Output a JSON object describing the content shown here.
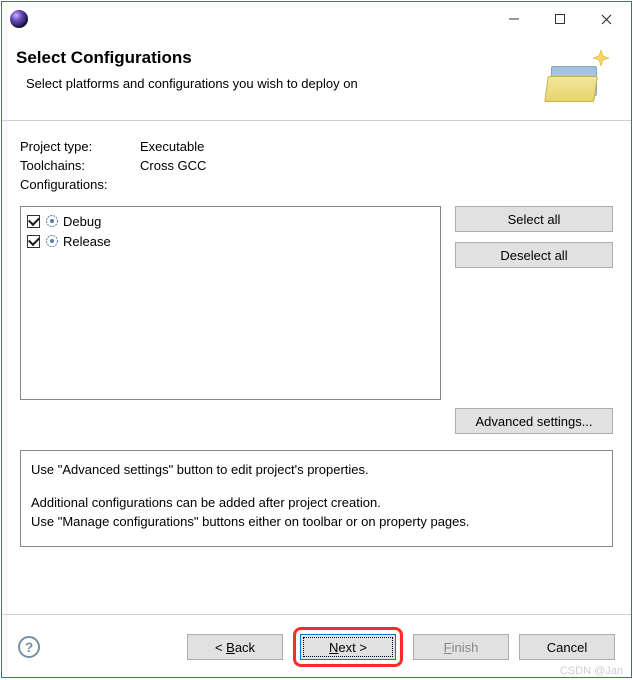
{
  "banner": {
    "title": "Select Configurations",
    "subtitle": "Select platforms and configurations you wish to deploy on"
  },
  "fields": {
    "project_type_label": "Project type:",
    "project_type_value": "Executable",
    "toolchains_label": "Toolchains:",
    "toolchains_value": "Cross GCC",
    "configurations_label": "Configurations:"
  },
  "configs": {
    "items": [
      {
        "label": "Debug",
        "checked": true
      },
      {
        "label": "Release",
        "checked": true
      }
    ]
  },
  "buttons": {
    "select_all": "Select all",
    "deselect_all": "Deselect all",
    "advanced": "Advanced settings...",
    "back": "< Back",
    "next": "Next >",
    "finish": "Finish",
    "cancel": "Cancel"
  },
  "mnemonics": {
    "back": "B",
    "next": "N",
    "finish": "F"
  },
  "note": {
    "line1": "Use \"Advanced settings\" button to edit project's properties.",
    "line2": "Additional configurations can be added after project creation.",
    "line3": "Use \"Manage configurations\" buttons either on toolbar or on property pages."
  },
  "watermark": "CSDN @Jan"
}
